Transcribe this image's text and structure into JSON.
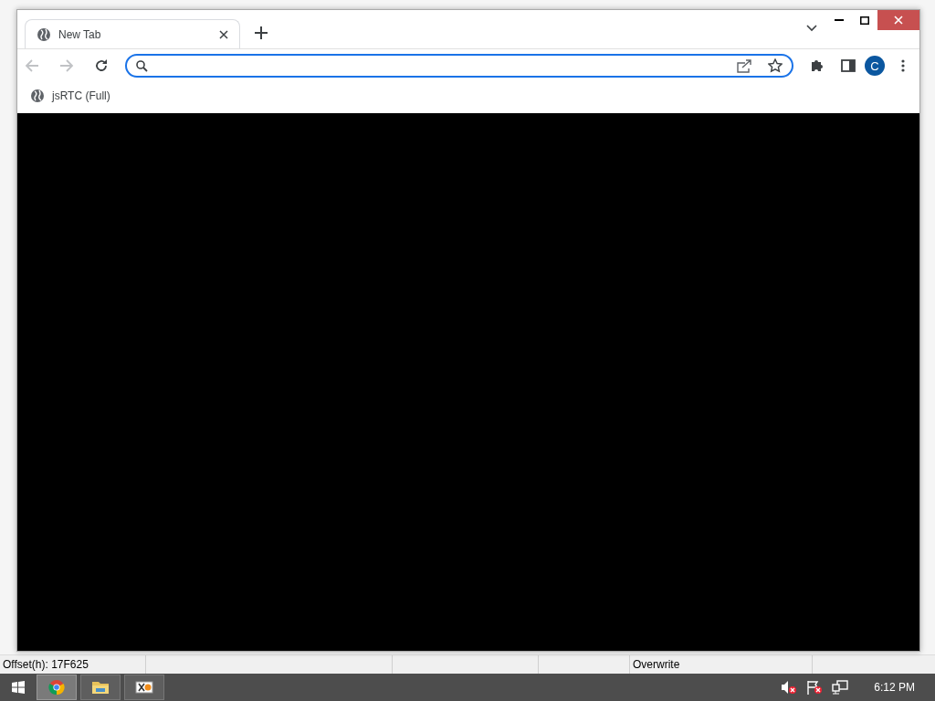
{
  "browser": {
    "tabs": [
      {
        "label": "New Tab",
        "selected": true
      }
    ],
    "profile": "C",
    "bookmarks": [
      {
        "label": "jsRTC (Full)"
      }
    ]
  },
  "editor_status_bar": {
    "offset": "Offset(h): 17F625",
    "mode": "Overwrite"
  },
  "taskbar": {
    "apps": [
      {
        "kind": "chrome",
        "selected": true
      },
      {
        "kind": "folder",
        "selected": false
      },
      {
        "kind": "hxd",
        "selected": false
      }
    ],
    "clock": "6:12 PM"
  }
}
